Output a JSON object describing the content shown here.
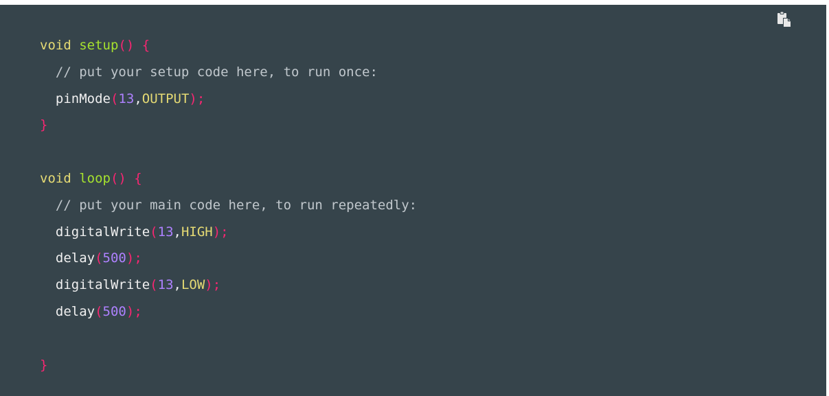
{
  "colors": {
    "background": "#36444b",
    "keyword": "#e6db74",
    "function": "#a6e22e",
    "punctuation": "#f92672",
    "number": "#ae81ff",
    "constant": "#e6db74",
    "comment": "#c0c7cc",
    "plain": "#f0f0f0",
    "icon": "#e8e8e8"
  },
  "copy_button": {
    "icon": "copy-icon"
  },
  "code_lines": [
    [
      {
        "text": "void",
        "kind": "keyword"
      },
      {
        "text": " ",
        "kind": "plain"
      },
      {
        "text": "setup",
        "kind": "function"
      },
      {
        "text": "() {",
        "kind": "punctuation"
      }
    ],
    [
      {
        "text": "  ",
        "kind": "plain"
      },
      {
        "text": "// put your setup code here, to run once:",
        "kind": "comment"
      }
    ],
    [
      {
        "text": "  ",
        "kind": "plain"
      },
      {
        "text": "pinMode",
        "kind": "plain"
      },
      {
        "text": "(",
        "kind": "punctuation"
      },
      {
        "text": "13",
        "kind": "number"
      },
      {
        "text": ",",
        "kind": "plain"
      },
      {
        "text": "OUTPUT",
        "kind": "constant"
      },
      {
        "text": ");",
        "kind": "punctuation"
      }
    ],
    [
      {
        "text": "}",
        "kind": "punctuation"
      }
    ],
    [],
    [
      {
        "text": "void",
        "kind": "keyword"
      },
      {
        "text": " ",
        "kind": "plain"
      },
      {
        "text": "loop",
        "kind": "function"
      },
      {
        "text": "() {",
        "kind": "punctuation"
      }
    ],
    [
      {
        "text": "  ",
        "kind": "plain"
      },
      {
        "text": "// put your main code here, to run repeatedly:",
        "kind": "comment"
      }
    ],
    [
      {
        "text": "  ",
        "kind": "plain"
      },
      {
        "text": "digitalWrite",
        "kind": "plain"
      },
      {
        "text": "(",
        "kind": "punctuation"
      },
      {
        "text": "13",
        "kind": "number"
      },
      {
        "text": ",",
        "kind": "plain"
      },
      {
        "text": "HIGH",
        "kind": "constant"
      },
      {
        "text": ");",
        "kind": "punctuation"
      }
    ],
    [
      {
        "text": "  ",
        "kind": "plain"
      },
      {
        "text": "delay",
        "kind": "plain"
      },
      {
        "text": "(",
        "kind": "punctuation"
      },
      {
        "text": "500",
        "kind": "number"
      },
      {
        "text": ");",
        "kind": "punctuation"
      }
    ],
    [
      {
        "text": "  ",
        "kind": "plain"
      },
      {
        "text": "digitalWrite",
        "kind": "plain"
      },
      {
        "text": "(",
        "kind": "punctuation"
      },
      {
        "text": "13",
        "kind": "number"
      },
      {
        "text": ",",
        "kind": "plain"
      },
      {
        "text": "LOW",
        "kind": "constant"
      },
      {
        "text": ");",
        "kind": "punctuation"
      }
    ],
    [
      {
        "text": "  ",
        "kind": "plain"
      },
      {
        "text": "delay",
        "kind": "plain"
      },
      {
        "text": "(",
        "kind": "punctuation"
      },
      {
        "text": "500",
        "kind": "number"
      },
      {
        "text": ");",
        "kind": "punctuation"
      }
    ],
    [],
    [
      {
        "text": "}",
        "kind": "punctuation"
      }
    ]
  ]
}
